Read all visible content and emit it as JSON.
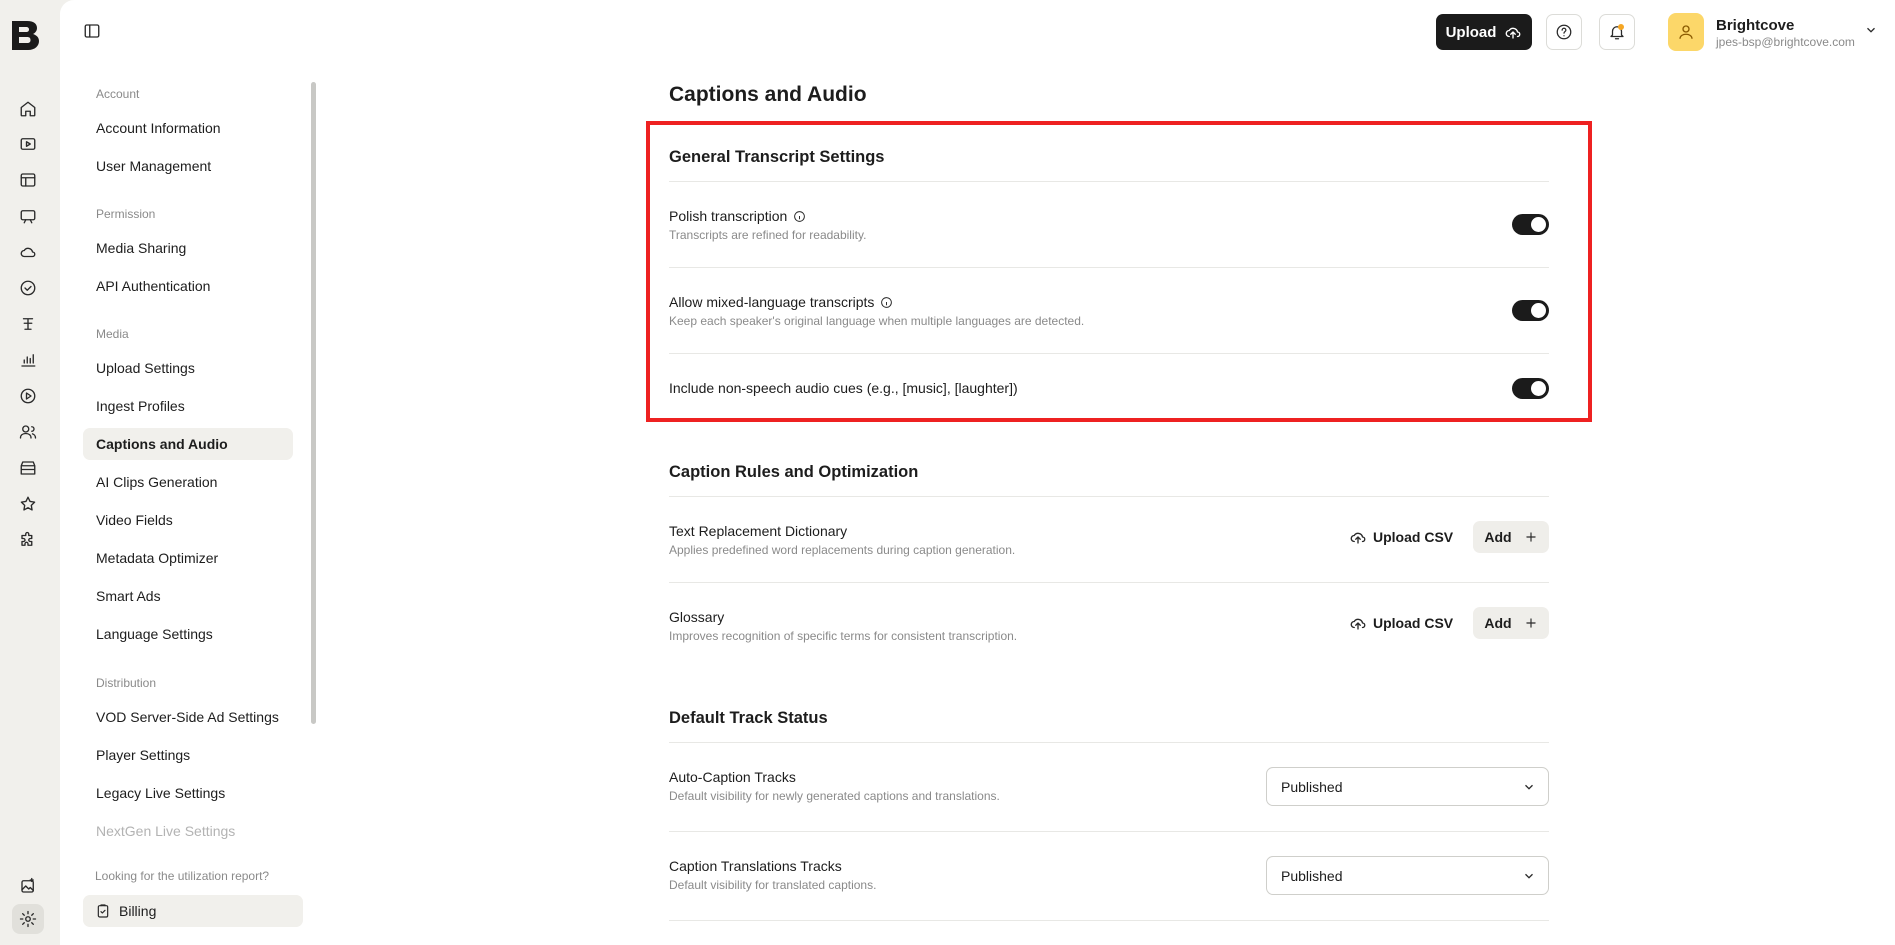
{
  "topbar": {
    "upload_label": "Upload",
    "profile_name": "Brightcove",
    "profile_email": "jpes-bsp@brightcove.com"
  },
  "settings_nav": {
    "sections": [
      {
        "label": "Account",
        "items": [
          "Account Information",
          "User Management"
        ]
      },
      {
        "label": "Permission",
        "items": [
          "Media Sharing",
          "API Authentication"
        ]
      },
      {
        "label": "Media",
        "items": [
          "Upload Settings",
          "Ingest Profiles",
          "Captions and Audio",
          "AI Clips Generation",
          "Video Fields",
          "Metadata Optimizer",
          "Smart Ads",
          "Language Settings"
        ]
      },
      {
        "label": "Distribution",
        "items": [
          "VOD Server-Side Ad Settings",
          "Player Settings",
          "Legacy Live Settings",
          "NextGen Live Settings"
        ]
      }
    ],
    "active_item": "Captions and Audio",
    "utilization_note": "Looking for the utilization report?",
    "billing_label": "Billing"
  },
  "page": {
    "title": "Captions and Audio",
    "general": {
      "title": "General Transcript Settings",
      "rows": [
        {
          "label": "Polish transcription",
          "description": "Transcripts are refined for readability.",
          "enabled": true
        },
        {
          "label": "Allow mixed-language transcripts",
          "description": "Keep each speaker's original language when multiple languages are detected.",
          "enabled": true
        },
        {
          "label": "Include non-speech audio cues (e.g., [music], [laughter])",
          "description": "",
          "enabled": true
        }
      ]
    },
    "caption_rules": {
      "title": "Caption Rules and Optimization",
      "upload_csv_label": "Upload CSV",
      "add_label": "Add",
      "rows": [
        {
          "label": "Text Replacement Dictionary",
          "description": "Applies predefined word replacements during caption generation."
        },
        {
          "label": "Glossary",
          "description": "Improves recognition of specific terms for consistent transcription."
        }
      ]
    },
    "default_track": {
      "title": "Default Track Status",
      "rows": [
        {
          "label": "Auto-Caption Tracks",
          "description": "Default visibility for newly generated captions and translations.",
          "value": "Published"
        },
        {
          "label": "Caption Translations Tracks",
          "description": "Default visibility for translated captions.",
          "value": "Published"
        }
      ]
    }
  }
}
